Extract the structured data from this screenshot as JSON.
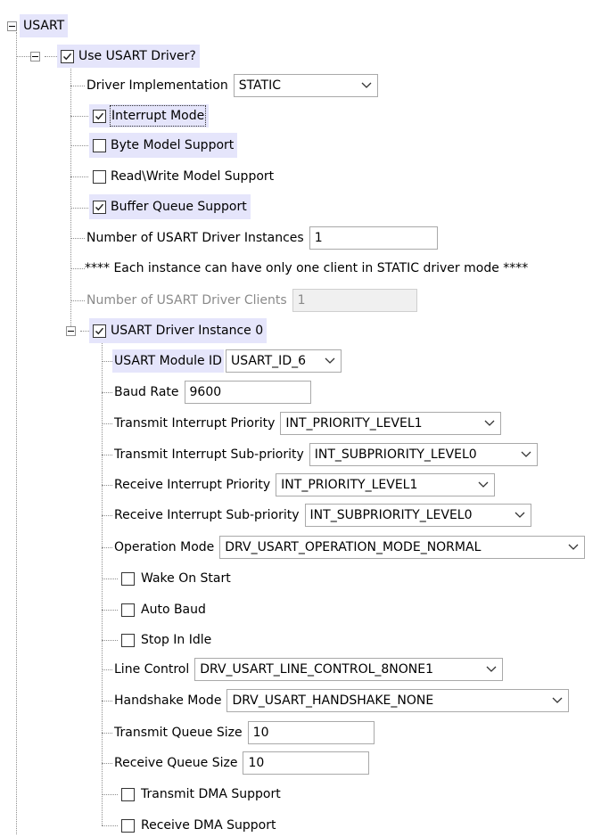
{
  "tree": {
    "root_label": "USART",
    "use_driver_label": "Use USART Driver?",
    "driver_impl": {
      "label": "Driver Implementation",
      "value": "STATIC"
    },
    "interrupt_mode_label": "Interrupt Mode",
    "byte_model_label": "Byte Model Support",
    "readwrite_model_label": "Read\\Write Model Support",
    "buffer_queue_label": "Buffer Queue Support",
    "num_instances": {
      "label": "Number of USART Driver Instances",
      "value": "1"
    },
    "static_note": "**** Each instance can have only one client in STATIC driver mode ****",
    "num_clients": {
      "label": "Number of USART Driver Clients",
      "value": "1"
    },
    "instance0": {
      "label": "USART Driver Instance 0",
      "module_id": {
        "label": "USART Module ID",
        "value": "USART_ID_6"
      },
      "baud_rate": {
        "label": "Baud Rate",
        "value": "9600"
      },
      "tx_int_priority": {
        "label": "Transmit Interrupt Priority",
        "value": "INT_PRIORITY_LEVEL1"
      },
      "tx_int_subpriority": {
        "label": "Transmit Interrupt Sub-priority",
        "value": "INT_SUBPRIORITY_LEVEL0"
      },
      "rx_int_priority": {
        "label": "Receive Interrupt Priority",
        "value": "INT_PRIORITY_LEVEL1"
      },
      "rx_int_subpriority": {
        "label": "Receive Interrupt Sub-priority",
        "value": "INT_SUBPRIORITY_LEVEL0"
      },
      "operation_mode": {
        "label": "Operation Mode",
        "value": "DRV_USART_OPERATION_MODE_NORMAL"
      },
      "wake_on_start_label": "Wake On Start",
      "auto_baud_label": "Auto Baud",
      "stop_in_idle_label": "Stop In Idle",
      "line_control": {
        "label": "Line Control",
        "value": "DRV_USART_LINE_CONTROL_8NONE1"
      },
      "handshake_mode": {
        "label": "Handshake Mode",
        "value": "DRV_USART_HANDSHAKE_NONE"
      },
      "tx_queue_size": {
        "label": "Transmit Queue Size",
        "value": "10"
      },
      "rx_queue_size": {
        "label": "Receive Queue Size",
        "value": "10"
      },
      "tx_dma_label": "Transmit DMA Support",
      "rx_dma_label": "Receive DMA Support"
    }
  },
  "states": {
    "use_driver_checked": true,
    "interrupt_mode_checked": true,
    "byte_model_checked": false,
    "readwrite_model_checked": false,
    "buffer_queue_checked": true,
    "instance0_checked": true,
    "wake_on_start_checked": false,
    "auto_baud_checked": false,
    "stop_in_idle_checked": false,
    "tx_dma_checked": false,
    "rx_dma_checked": false
  },
  "colors": {
    "highlight": "#e5e5fb",
    "border": "#a9a9a9",
    "disabled_text": "#8a8a8a"
  }
}
